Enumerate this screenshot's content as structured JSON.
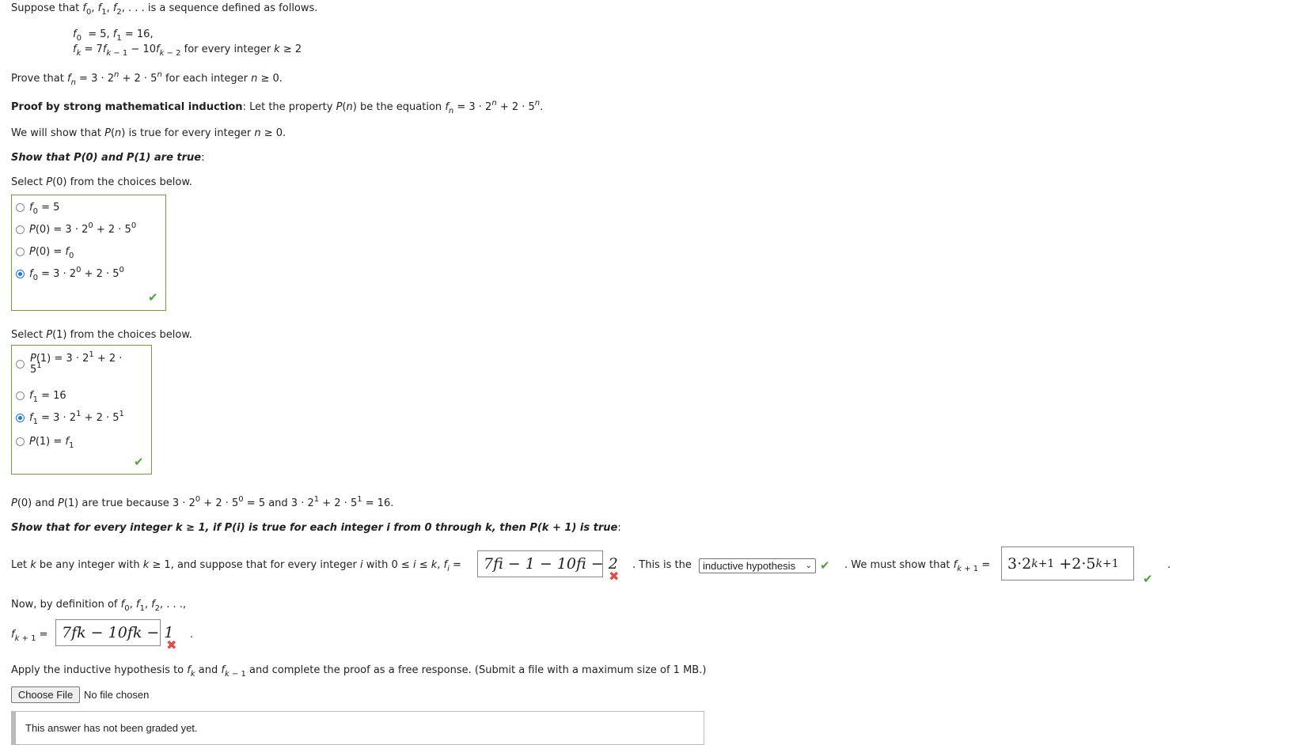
{
  "intro": {
    "suppose_pre": "Suppose that ",
    "suppose_post": " is a sequence defined as follows.",
    "def_line1": "= 5, ",
    "def_line1b": "= 16,",
    "def_line2_tail": "for every integer ",
    "def_line2_cond": "≥ 2",
    "prove_pre": "Prove that ",
    "prove_post": " for each integer ",
    "prove_cond": "≥ 0."
  },
  "proof": {
    "title_bold": "Proof by strong mathematical induction",
    "title_rest": ": Let the property ",
    "title_rest2": " be the equation ",
    "will_show": "We will show that ",
    "will_show2": " is true for every integer ",
    "will_show3": "≥ 0."
  },
  "base": {
    "heading": "Show that P(0) and P(1) are true",
    "select_p0": "Select",
    "select_p0_tail": " from the choices below.",
    "p0_options": [
      {
        "label": "f₀ = 5",
        "selected": false
      },
      {
        "label": "P(0) = 3 · 2⁰ + 2 · 5⁰",
        "selected": false
      },
      {
        "label": "P(0) = f₀",
        "selected": false
      },
      {
        "label": "f₀ = 3 · 2⁰ + 2 · 5⁰",
        "selected": true
      }
    ],
    "p0_status": "correct",
    "select_p1": "Select",
    "p1_options": [
      {
        "label": "P(1) = 3 · 2¹ + 2 · 5¹",
        "selected": false
      },
      {
        "label": "f₁ = 16",
        "selected": false
      },
      {
        "label": "f₁ = 3 · 2¹ + 2 · 5¹",
        "selected": true
      },
      {
        "label": "P(1) = f₁",
        "selected": false
      }
    ],
    "p1_status": "correct",
    "conclusion": "are true because 3 · 2⁰ + 2 · 5⁰ = 5 and 3 · 2¹ + 2 · 5¹ = 16."
  },
  "inductive": {
    "heading": "Show that for every integer k ≥ 1, if P(i) is true for each integer i from 0 through k, then P(k + 1) is true",
    "let_text": "be any integer with ",
    "let_text2": "≥ 1, and suppose that for every integer ",
    "let_text3": "with 0 ≤ ",
    "let_text4": "≤ ",
    "answer1": "7fi − 1 − 10fi − 2",
    "answer1_status": "incorrect",
    "this_is_the": ". This is the",
    "dropdown_value": "inductive hypothesis",
    "dropdown_status": "correct",
    "must_show": ". We must show that ",
    "answer2": "3·2^(k+1) + 2·5^(k+1)",
    "answer2_status": "correct",
    "now_text": "Now, by definition of ",
    "answer3": "7fk − 10fk − 1",
    "answer3_status": "incorrect",
    "apply_text": "Apply the inductive hypothesis to ",
    "apply_and": " and ",
    "apply_tail": " and complete the proof as a free response. (Submit a file with a maximum size of 1 MB.)",
    "file_button": "Choose File",
    "file_status": "No file chosen",
    "graded_message": "This answer has not been graded yet."
  },
  "colors": {
    "correct": "#4aa53a",
    "incorrect": "#e04a4a",
    "box_border": "#6aa33a",
    "radio_selected": "#1a73e8"
  }
}
